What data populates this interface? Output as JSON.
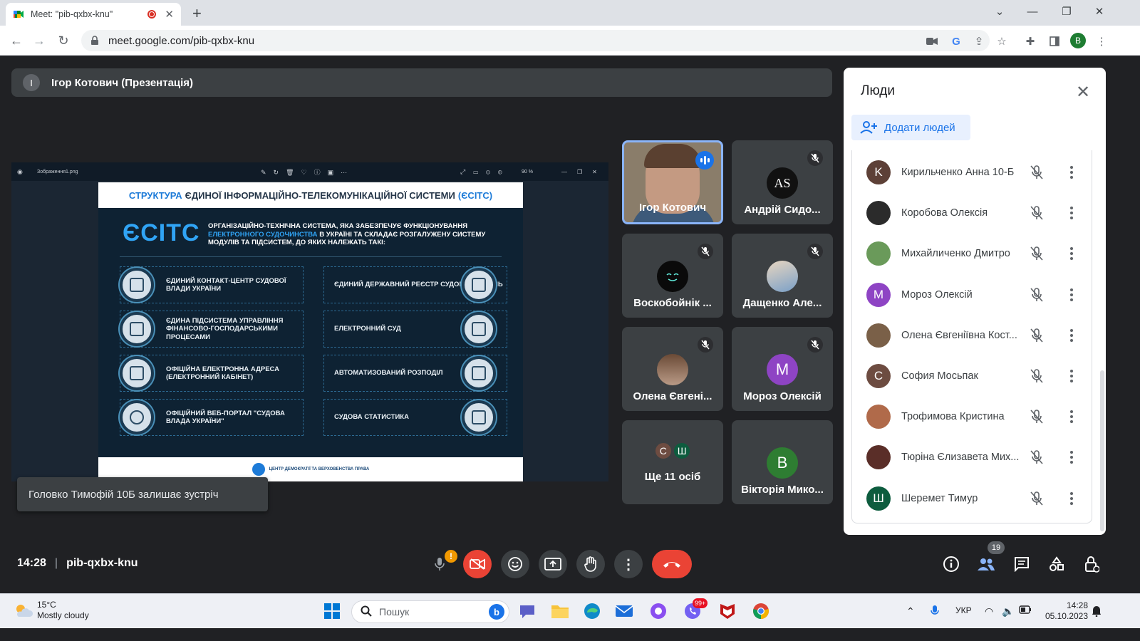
{
  "browser": {
    "tab_title": "Meet: \"pib-qxbx-knu\"",
    "url": "meet.google.com/pib-qxbx-knu",
    "profile_initial": "B"
  },
  "meet": {
    "presenter_initial": "I",
    "presenter_label": "Ігор Котович (Презентація)",
    "toast": "Головко Тимофій 10Б залишає зустріч",
    "time": "14:28",
    "meeting_code": "pib-qxbx-knu",
    "people_count": "19"
  },
  "presentation": {
    "file_name": "Зображення1.png",
    "zoom": "90 %",
    "title_part1": "СТРУКТУРА",
    "title_part2": "ЄДИНОЇ ІНФОРМАЦІЙНО-ТЕЛЕКОМУНІКАЦІЙНОЇ СИСТЕМИ",
    "title_part3": "(ЄСІТС)",
    "brand": "ЄСІТС",
    "desc_part1": "ОРГАНІЗАЦІЙНО-ТЕХНІЧНА СИСТЕМА, ЯКА ЗАБЕЗПЕЧУЄ ФУНКЦІОНУВАННЯ",
    "desc_accent": "ЕЛЕКТРОННОГО СУДОЧИНСТВА",
    "desc_part2": "В УКРАЇНІ ТА СКЛАДАЄ РОЗГАЛУЖЕНУ СИСТЕМУ МОДУЛІВ ТА ПІДСИСТЕМ, ДО ЯКИХ НАЛЕЖАТЬ ТАКІ:",
    "items_left": [
      "ЄДИНИЙ КОНТАКТ-ЦЕНТР СУДОВОЇ ВЛАДИ УКРАЇНИ",
      "ЄДИНА ПІДСИСТЕМА УПРАВЛІННЯ ФІНАНСОВО-ГОСПОДАРСЬКИМИ ПРОЦЕСАМИ",
      "ОФІЦІЙНА ЕЛЕКТРОННА АДРЕСА (ЕЛЕКТРОННИЙ КАБІНЕТ)",
      "ОФІЦІЙНИЙ ВЕБ-ПОРТАЛ \"СУДОВА ВЛАДА УКРАЇНИ\""
    ],
    "items_right": [
      "ЄДИНИЙ ДЕРЖАВНИЙ РЕЄСТР СУДОВИХ РІШЕНЬ",
      "ЕЛЕКТРОННИЙ СУД",
      "АВТОМАТИЗОВАНИЙ РОЗПОДІЛ",
      "СУДОВА СТАТИСТИКА"
    ],
    "footer": "ЦЕНТР ДЕМОКРАТІЇ ТА ВЕРХОВЕНСТВА ПРАВА"
  },
  "tiles": [
    {
      "name": "Ігор Котович"
    },
    {
      "name": "Андрій Сидо...",
      "avatar": "AS"
    },
    {
      "name": "Воскобойнік ..."
    },
    {
      "name": "Дащенко Але..."
    },
    {
      "name": "Олена Євгені..."
    },
    {
      "name": "Мороз Олексій",
      "avatar": "M"
    },
    {
      "name": "Ще 11 осіб",
      "mini1": "С",
      "mini2": "Ш"
    },
    {
      "name": "Вікторія Мико...",
      "avatar": "B"
    }
  ],
  "people_panel": {
    "title": "Люди",
    "add_label": "Додати людей",
    "people": [
      {
        "name": "Кирильченко Анна 10-Б",
        "initial": "K",
        "color": "#5d4037"
      },
      {
        "name": "Коробова Олексія",
        "initial": "",
        "color": "#2b2b2b"
      },
      {
        "name": "Михайличенко Дмитро",
        "initial": "",
        "color": "#6a9a5a"
      },
      {
        "name": "Мороз Олексій",
        "initial": "M",
        "color": "#8e44c4"
      },
      {
        "name": "Олена Євгеніївна Кост...",
        "initial": "",
        "color": "#7a6048"
      },
      {
        "name": "София Мосьпак",
        "initial": "C",
        "color": "#6d4c41"
      },
      {
        "name": "Трофимова Кристина",
        "initial": "",
        "color": "#b06a4a"
      },
      {
        "name": "Тюріна Єлизавета Мих...",
        "initial": "",
        "color": "#5a2e28"
      },
      {
        "name": "Шеремет Тимур",
        "initial": "Ш",
        "color": "#0d5c3e"
      }
    ]
  },
  "taskbar": {
    "temp": "15°C",
    "weather": "Mostly cloudy",
    "search_placeholder": "Пошук",
    "lang": "УКР",
    "time": "14:28",
    "date": "05.10.2023",
    "viber_badge": "99+"
  }
}
